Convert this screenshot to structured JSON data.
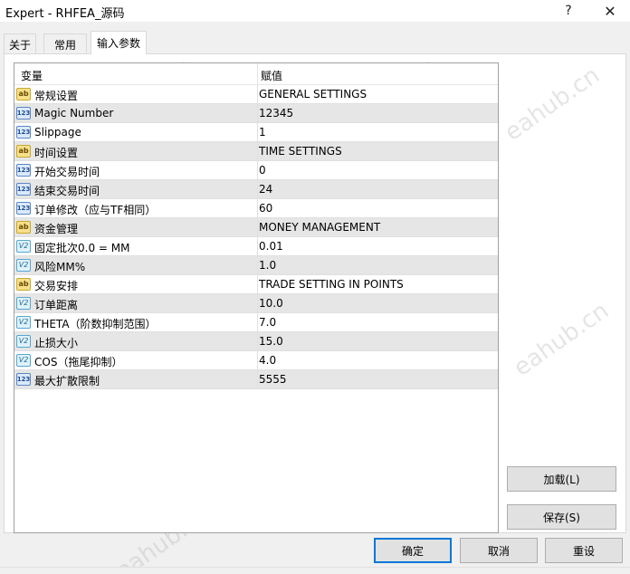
{
  "window": {
    "title": "Expert - RHFEA_源码",
    "help_label": "?",
    "close_label": "✕"
  },
  "tabs": [
    {
      "label": "关于"
    },
    {
      "label": "常用"
    },
    {
      "label": "输入参数"
    }
  ],
  "grid": {
    "headers": {
      "variable": "变量",
      "value": "赋值"
    },
    "rows": [
      {
        "icon": "ab-icon",
        "name": "常规设置",
        "value": "GENERAL SETTINGS"
      },
      {
        "icon": "int-icon",
        "name": "Magic Number",
        "value": "12345"
      },
      {
        "icon": "int-icon",
        "name": "Slippage",
        "value": "1"
      },
      {
        "icon": "ab-icon",
        "name": "时间设置",
        "value": "TIME SETTINGS"
      },
      {
        "icon": "int-icon",
        "name": "开始交易时间",
        "value": "0"
      },
      {
        "icon": "int-icon",
        "name": "结束交易时间",
        "value": "24"
      },
      {
        "icon": "int-icon",
        "name": "订单修改（应与TF相同）",
        "value": "60"
      },
      {
        "icon": "ab-icon",
        "name": "资金管理",
        "value": "MONEY MANAGEMENT"
      },
      {
        "icon": "double-icon",
        "name": "固定批次0.0 = MM",
        "value": "0.01"
      },
      {
        "icon": "double-icon",
        "name": "风险MM%",
        "value": "1.0"
      },
      {
        "icon": "ab-icon",
        "name": "交易安排",
        "value": "TRADE SETTING IN POINTS"
      },
      {
        "icon": "double-icon",
        "name": "订单距离",
        "value": "10.0"
      },
      {
        "icon": "double-icon",
        "name": "THETA（阶数抑制范围）",
        "value": "7.0"
      },
      {
        "icon": "double-icon",
        "name": "止损大小",
        "value": "15.0"
      },
      {
        "icon": "double-icon",
        "name": "COS（拖尾抑制）",
        "value": "4.0"
      },
      {
        "icon": "int-icon",
        "name": "最大扩散限制",
        "value": "5555"
      }
    ]
  },
  "buttons": {
    "load": "加载(L)",
    "save": "保存(S)",
    "ok": "确定",
    "cancel": "取消",
    "reset": "重设"
  },
  "icon_glyphs": {
    "ab": "ab",
    "int": "123",
    "double": "V2"
  },
  "watermark": "eahub.cn"
}
